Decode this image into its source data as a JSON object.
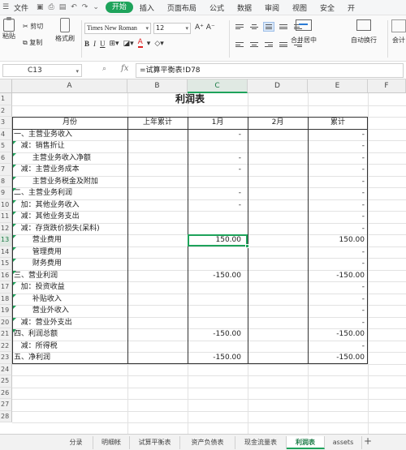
{
  "menubar": {
    "menu_icon": "menu-icon",
    "file_label": "文件",
    "tabs": [
      "开始",
      "插入",
      "页面布局",
      "公式",
      "数据",
      "审阅",
      "视图",
      "安全",
      "开"
    ],
    "active_tab_index": 0
  },
  "ribbon": {
    "paste_label": "粘贴",
    "cut_label": "剪切",
    "copy_label": "复制",
    "format_painter_label": "格式刷",
    "font_name": "Times New Roman",
    "font_size": "12",
    "merge_label": "合并居中",
    "wrap_label": "自动换行",
    "number_format_label": "会计"
  },
  "formula_bar": {
    "cell_ref": "C13",
    "fx_label": "fx",
    "formula": "=试算平衡表!D78"
  },
  "columns": [
    "A",
    "B",
    "C",
    "D",
    "E",
    "F"
  ],
  "selected_column": "C",
  "selected_row": "13",
  "rows": [
    "1",
    "2",
    "3",
    "4",
    "5",
    "6",
    "7",
    "8",
    "9",
    "10",
    "11",
    "12",
    "13",
    "14",
    "15",
    "16",
    "17",
    "18",
    "19",
    "20",
    "21",
    "22",
    "23",
    "24",
    "25",
    "26",
    "27",
    "28",
    "29",
    "30"
  ],
  "sheet": {
    "title": "利润表",
    "headers": [
      "月份",
      "上年累计",
      "1月",
      "2月",
      "累计"
    ],
    "lines": [
      {
        "label": "一、主营业务收入",
        "c": "-",
        "e": "-"
      },
      {
        "label": "   减：销售折让",
        "c": "",
        "e": "-"
      },
      {
        "label": "        主营业务收入净额",
        "c": "-",
        "e": "-"
      },
      {
        "label": "   减：主营业务成本",
        "c": "-",
        "e": "-"
      },
      {
        "label": "        主营业务税金及附加",
        "c": "",
        "e": "-"
      },
      {
        "label": "二、主营业务利润",
        "c": "-",
        "e": "-"
      },
      {
        "label": "   加：其他业务收入",
        "c": "-",
        "e": "-"
      },
      {
        "label": "   减：其他业务支出",
        "c": "",
        "e": "-"
      },
      {
        "label": "   减：存货跌价损失(呆料)",
        "c": "",
        "e": "-"
      },
      {
        "label": "        营业费用",
        "c": "150.00",
        "e": "150.00"
      },
      {
        "label": "        管理费用",
        "c": "",
        "e": "-"
      },
      {
        "label": "        财务费用",
        "c": "",
        "e": "-"
      },
      {
        "label": "三、营业利润",
        "c": "-150.00",
        "e": "-150.00"
      },
      {
        "label": "   加：投资收益",
        "c": "",
        "e": "-"
      },
      {
        "label": "        补贴收入",
        "c": "",
        "e": "-"
      },
      {
        "label": "        营业外收入",
        "c": "",
        "e": "-"
      },
      {
        "label": "   减：营业外支出",
        "c": "",
        "e": "-"
      },
      {
        "label": "四、利润总额",
        "c": "-150.00",
        "e": "-150.00"
      },
      {
        "label": "   减：所得税",
        "c": "",
        "e": "-"
      },
      {
        "label": "五、净利润",
        "c": "-150.00",
        "e": "-150.00"
      }
    ]
  },
  "sheet_tabs": [
    "分录",
    "明细帐",
    "试算平衡表",
    "资产负债表",
    "现金流量表",
    "利润表",
    "assets"
  ],
  "active_sheet": "利润表",
  "colors": {
    "accent": "#1ea35b",
    "selection": "#1ea35b"
  }
}
